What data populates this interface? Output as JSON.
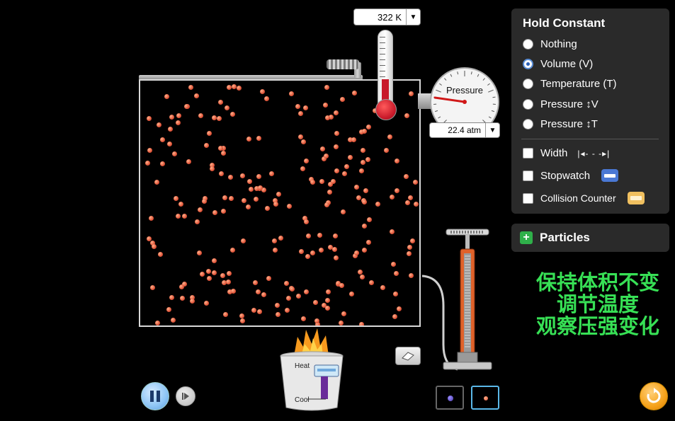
{
  "thermometer": {
    "readout": "322 K"
  },
  "gauge": {
    "label": "Pressure",
    "readout": "22.4 atm"
  },
  "hold_constant": {
    "title": "Hold Constant",
    "options": [
      {
        "label": "Nothing",
        "selected": false
      },
      {
        "label": "Volume (V)",
        "selected": true
      },
      {
        "label": "Temperature (T)",
        "selected": false
      },
      {
        "label": "Pressure ↕V",
        "selected": false
      },
      {
        "label": "Pressure ↕T",
        "selected": false
      }
    ]
  },
  "tools": {
    "width_label": "Width",
    "width_icon_text": "|◂- - -▸|",
    "stopwatch_label": "Stopwatch",
    "collision_label": "Collision Counter"
  },
  "particles_panel": {
    "label": "Particles"
  },
  "bucket": {
    "heat_label": "Heat",
    "cool_label": "Cool"
  },
  "caption": {
    "lines": [
      "保持体积不变",
      "调节温度",
      "观察压强变化"
    ]
  },
  "colors": {
    "particle": "#e0553a",
    "accent_green": "#37e055",
    "panel_bg": "#2a2a2a",
    "selected_radio": "#2a5fb8"
  },
  "icons": [
    "chevron-down-icon",
    "plus-icon",
    "eraser-icon",
    "pause-icon",
    "step-icon",
    "reset-icon",
    "flame-icon",
    "stopwatch-icon",
    "counter-icon",
    "width-icon"
  ]
}
